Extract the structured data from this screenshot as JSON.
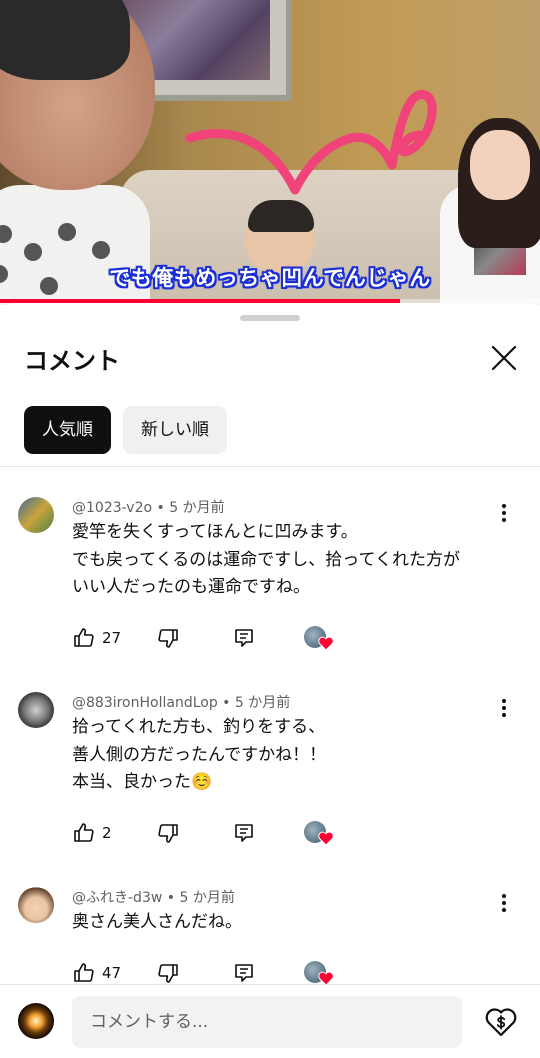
{
  "video": {
    "subtitle": "でも俺もめっちゃ凹んでんじゃん",
    "progress": 0.74
  },
  "sheet": {
    "title": "コメント",
    "sort_chips": [
      {
        "label": "人気順",
        "active": true
      },
      {
        "label": "新しい順",
        "active": false
      }
    ]
  },
  "comments": [
    {
      "handle": "@1023-v2o",
      "time": "5 か月前",
      "lines": [
        "愛竿を失くすってほんとに凹みます。",
        "でも戻ってくるのは運命ですし、拾ってくれた方が",
        "いい人だったのも運命ですね。"
      ],
      "likes": "27"
    },
    {
      "handle": "@883ironHollandLop",
      "time": "5 か月前",
      "lines": [
        "拾ってくれた方も、釣りをする、",
        "善人側の方だったんですかね！！",
        "本当、良かった☺️"
      ],
      "likes": "2"
    },
    {
      "handle": "@ふれき-d3w",
      "time": "5 か月前",
      "lines": [
        "奥さん美人さんだね。"
      ],
      "likes": "47"
    }
  ],
  "composer": {
    "placeholder": "コメントする..."
  },
  "colors": {
    "accent": "#ff0033",
    "heart": "#ff0033",
    "subtitle_outline": "#1a2fd6"
  }
}
